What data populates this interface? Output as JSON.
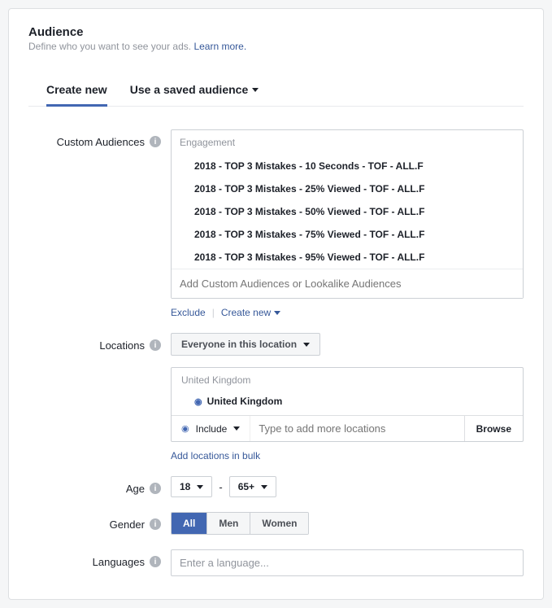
{
  "header": {
    "title": "Audience",
    "subtitle": "Define who you want to see your ads. ",
    "learn_more": "Learn more."
  },
  "tabs": {
    "create": "Create new",
    "saved": "Use a saved audience"
  },
  "custom_audiences": {
    "label": "Custom Audiences",
    "group_label": "Engagement",
    "items": [
      "2018 - TOP 3 Mistakes - 10 Seconds - TOF - ALL.F",
      "2018 - TOP 3 Mistakes - 25% Viewed - TOF - ALL.F",
      "2018 - TOP 3 Mistakes - 50% Viewed - TOF - ALL.F",
      "2018 - TOP 3 Mistakes - 75% Viewed - TOF - ALL.F",
      "2018 - TOP 3 Mistakes - 95% Viewed - TOF - ALL.F"
    ],
    "placeholder": "Add Custom Audiences or Lookalike Audiences",
    "exclude": "Exclude",
    "create_new": "Create new"
  },
  "locations": {
    "label": "Locations",
    "mode": "Everyone in this location",
    "region": "United Kingdom",
    "item": "United Kingdom",
    "include": "Include",
    "placeholder": "Type to add more locations",
    "browse": "Browse",
    "bulk": "Add locations in bulk"
  },
  "age": {
    "label": "Age",
    "min": "18",
    "max": "65+"
  },
  "gender": {
    "label": "Gender",
    "all": "All",
    "men": "Men",
    "women": "Women"
  },
  "languages": {
    "label": "Languages",
    "placeholder": "Enter a language..."
  }
}
